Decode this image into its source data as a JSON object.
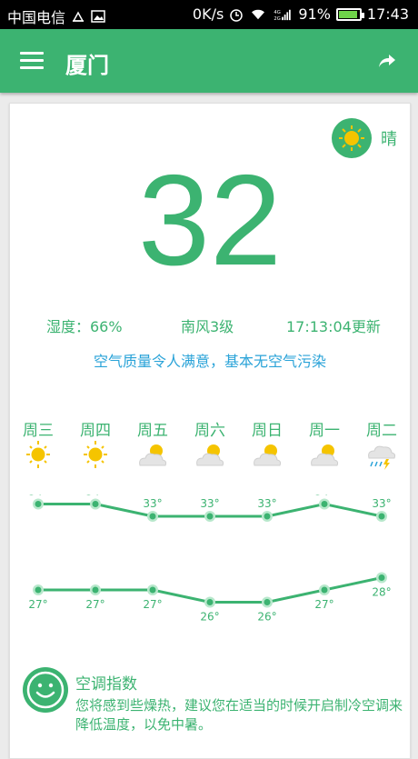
{
  "status_bar": {
    "carrier": "中国电信",
    "speed": "0K/s",
    "network": "4G 2G",
    "battery": "91%",
    "battery_level": 0.91,
    "time": "17:43"
  },
  "app_bar": {
    "city": "厦门",
    "menu_icon": "hamburger-menu-icon",
    "share_icon": "share-arrow-icon"
  },
  "current": {
    "condition": "晴",
    "condition_icon": "sun-icon",
    "temperature": "32",
    "humidity": "湿度：66%",
    "wind": "南风3级",
    "updated": "17:13:04更新",
    "air_quality": "空气质量令人满意，基本无空气污染"
  },
  "forecast": [
    {
      "day": "周三",
      "icon": "sun-icon",
      "high": 34,
      "low": 27
    },
    {
      "day": "周四",
      "icon": "sun-icon",
      "high": 34,
      "low": 27
    },
    {
      "day": "周五",
      "icon": "partly-cloudy-icon",
      "high": 33,
      "low": 27
    },
    {
      "day": "周六",
      "icon": "partly-cloudy-icon",
      "high": 33,
      "low": 26
    },
    {
      "day": "周日",
      "icon": "partly-cloudy-icon",
      "high": 33,
      "low": 26
    },
    {
      "day": "周一",
      "icon": "partly-cloudy-icon",
      "high": 34,
      "low": 27
    },
    {
      "day": "周二",
      "icon": "thunderstorm-icon",
      "high": 33,
      "low": 28
    }
  ],
  "chart_data": {
    "type": "line",
    "categories": [
      "周三",
      "周四",
      "周五",
      "周六",
      "周日",
      "周一",
      "周二"
    ],
    "series": [
      {
        "values": [
          34,
          34,
          33,
          33,
          33,
          34,
          33
        ]
      },
      {
        "values": [
          27,
          27,
          27,
          26,
          26,
          27,
          28
        ]
      }
    ],
    "unit": "°",
    "ylim": [
      25,
      35
    ],
    "color": "#3cb371"
  },
  "index": {
    "title": "空调指数",
    "description": "您将感到些燥热，建议您在适当的时候开启制冷空调来降低温度，以免中暑。",
    "icon": "smiley-icon"
  },
  "colors": {
    "primary": "#3cb371",
    "air_text": "#2aa3d8",
    "sun": "#f5c400"
  }
}
